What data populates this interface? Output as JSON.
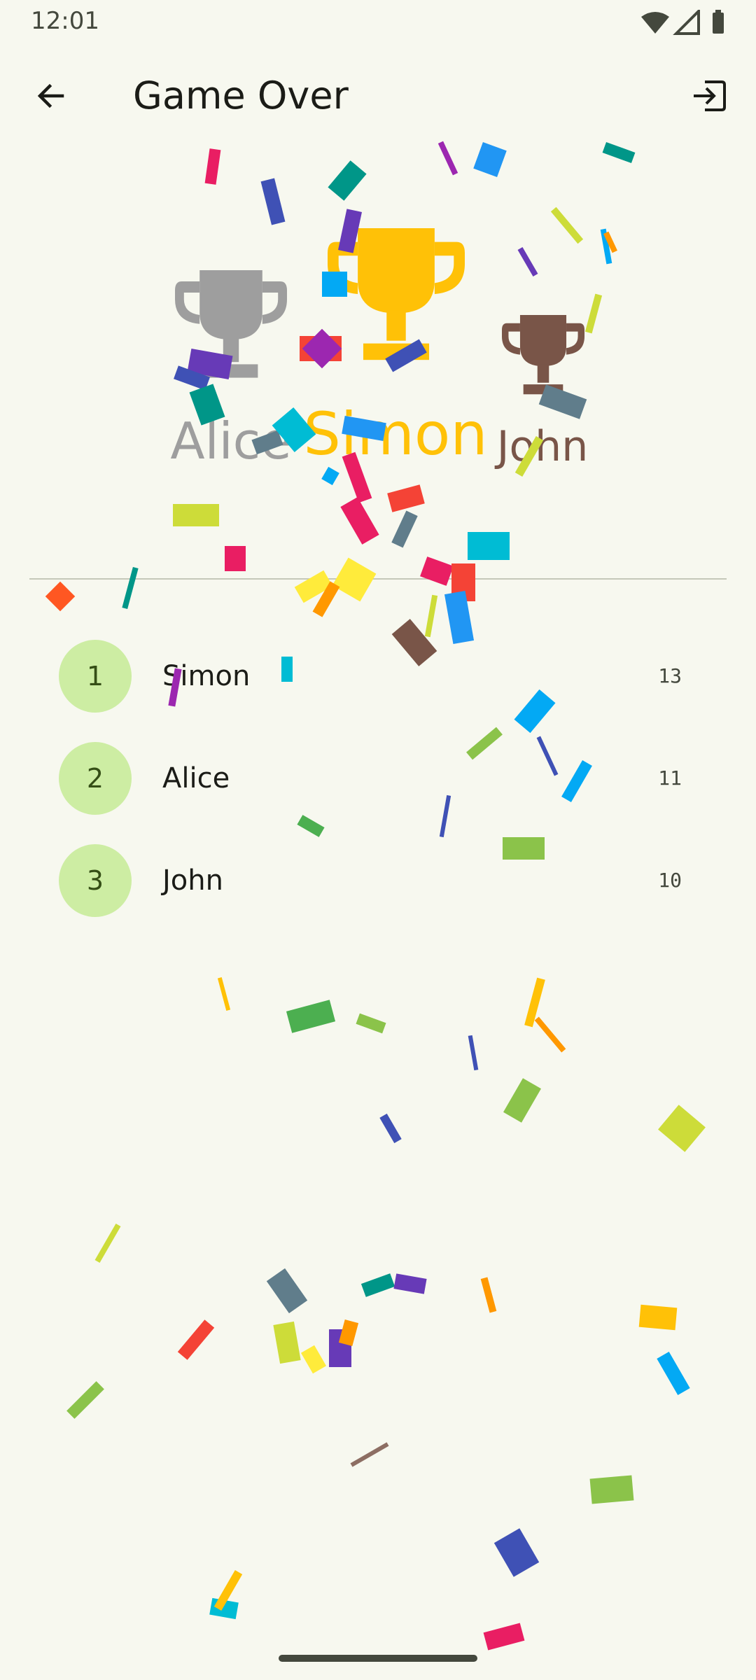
{
  "status_bar": {
    "time": "12:01",
    "icons": [
      "wifi-icon",
      "signal-icon",
      "battery-icon"
    ]
  },
  "app_bar": {
    "title": "Game Over",
    "back_icon": "arrow-back-icon",
    "exit_icon": "exit-icon"
  },
  "podium": [
    {
      "place": 2,
      "name": "Alice",
      "color": "#9e9e9e"
    },
    {
      "place": 1,
      "name": "Simon",
      "color": "#ffc107"
    },
    {
      "place": 3,
      "name": "John",
      "color": "#795548"
    }
  ],
  "rankings": [
    {
      "rank": "1",
      "name": "Simon",
      "score": "13"
    },
    {
      "rank": "2",
      "name": "Alice",
      "score": "11"
    },
    {
      "rank": "3",
      "name": "John",
      "score": "10"
    }
  ],
  "colors": {
    "background": "#f7f8ef",
    "rank_badge": "#cdeda3",
    "gold": "#ffc107",
    "silver": "#9e9e9e",
    "bronze": "#795548"
  }
}
